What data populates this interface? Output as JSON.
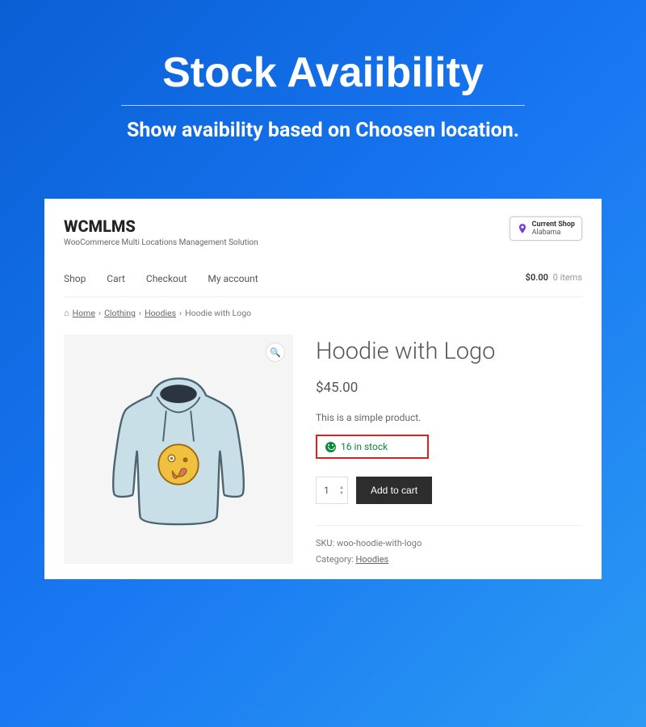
{
  "hero": {
    "title": "Stock Avaiibility",
    "subtitle": "Show avaibility based on Choosen location."
  },
  "brand": {
    "name": "WCMLMS",
    "tagline": "WooCommerce Multi Locations Management Solution"
  },
  "shop_badge": {
    "label": "Current Shop",
    "location": "Alabama"
  },
  "nav": {
    "items": [
      "Shop",
      "Cart",
      "Checkout",
      "My account"
    ]
  },
  "cart": {
    "total": "$0.00",
    "items_text": "0 items"
  },
  "breadcrumbs": {
    "items": [
      "Home",
      "Clothing",
      "Hoodies"
    ],
    "current": "Hoodie with Logo"
  },
  "product": {
    "title": "Hoodie with Logo",
    "price": "$45.00",
    "description": "This is a simple product.",
    "stock_text": "16 in stock",
    "quantity": "1",
    "add_button": "Add to cart",
    "sku_label": "SKU:",
    "sku_value": "woo-hoodie-with-logo",
    "category_label": "Category:",
    "category_value": "Hoodies"
  }
}
